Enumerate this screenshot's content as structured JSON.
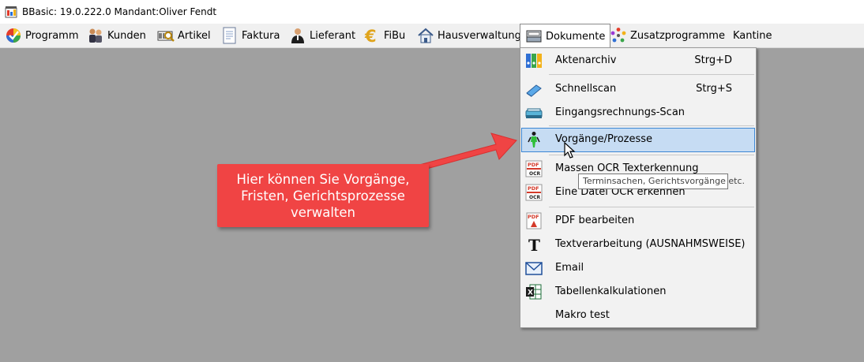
{
  "window": {
    "title": "BBasic: 19.0.222.0 Mandant:Oliver Fendt"
  },
  "menubar": {
    "items": [
      {
        "label": "Programm",
        "icon": "programm-icon"
      },
      {
        "label": "Kunden",
        "icon": "kunden-icon"
      },
      {
        "label": "Artikel",
        "icon": "artikel-icon"
      },
      {
        "label": "Faktura",
        "icon": "faktura-icon"
      },
      {
        "label": "Lieferant",
        "icon": "lieferant-icon"
      },
      {
        "label": "FiBu",
        "icon": "euro-icon"
      },
      {
        "label": "Hausverwaltung",
        "icon": "house-icon"
      },
      {
        "label": "Dokumente",
        "icon": "inbox-tray-icon"
      },
      {
        "label": "Zusatzprogramme",
        "icon": "people-circle-icon"
      },
      {
        "label": "Kantine",
        "icon": ""
      }
    ]
  },
  "dokumente_menu": {
    "items": [
      {
        "label": "Aktenarchiv",
        "shortcut": "Strg+D",
        "icon": "binders-icon"
      },
      {
        "label": "Schnellscan",
        "shortcut": "Strg+S",
        "icon": "scanner-icon"
      },
      {
        "label": "Eingangsrechnungs-Scan",
        "shortcut": "",
        "icon": "flatbed-scanner-icon"
      },
      {
        "label": "Vorgänge/Prozesse",
        "shortcut": "",
        "icon": "person-walking-icon"
      },
      {
        "label": "Massen OCR Texterkennung",
        "shortcut": "",
        "icon": "pdf-ocr-icon"
      },
      {
        "label": "Eine Datei OCR erkennen",
        "shortcut": "",
        "icon": "pdf-ocr-icon"
      },
      {
        "label": "PDF bearbeiten",
        "shortcut": "",
        "icon": "pdf-icon"
      },
      {
        "label": "Textverarbeitung (AUSNAHMSWEISE)",
        "shortcut": "",
        "icon": "text-t-icon"
      },
      {
        "label": "Email",
        "shortcut": "",
        "icon": "envelope-icon"
      },
      {
        "label": "Tabellenkalkulationen",
        "shortcut": "",
        "icon": "excel-icon"
      },
      {
        "label": "Makro test",
        "shortcut": "",
        "icon": ""
      }
    ],
    "highlighted": "Vorgänge/Prozesse"
  },
  "tooltip": {
    "text": "Terminsachen, Gerichtsvorgänge etc."
  },
  "callout": {
    "lines": [
      "Hier können Sie Vorgänge,",
      "Fristen, Gerichtsprozesse",
      "verwalten"
    ],
    "color": "#f04444"
  },
  "colors": {
    "highlight_bg": "#c6dcf3",
    "highlight_border": "#3c87d4",
    "desktop": "#a0a0a0"
  }
}
